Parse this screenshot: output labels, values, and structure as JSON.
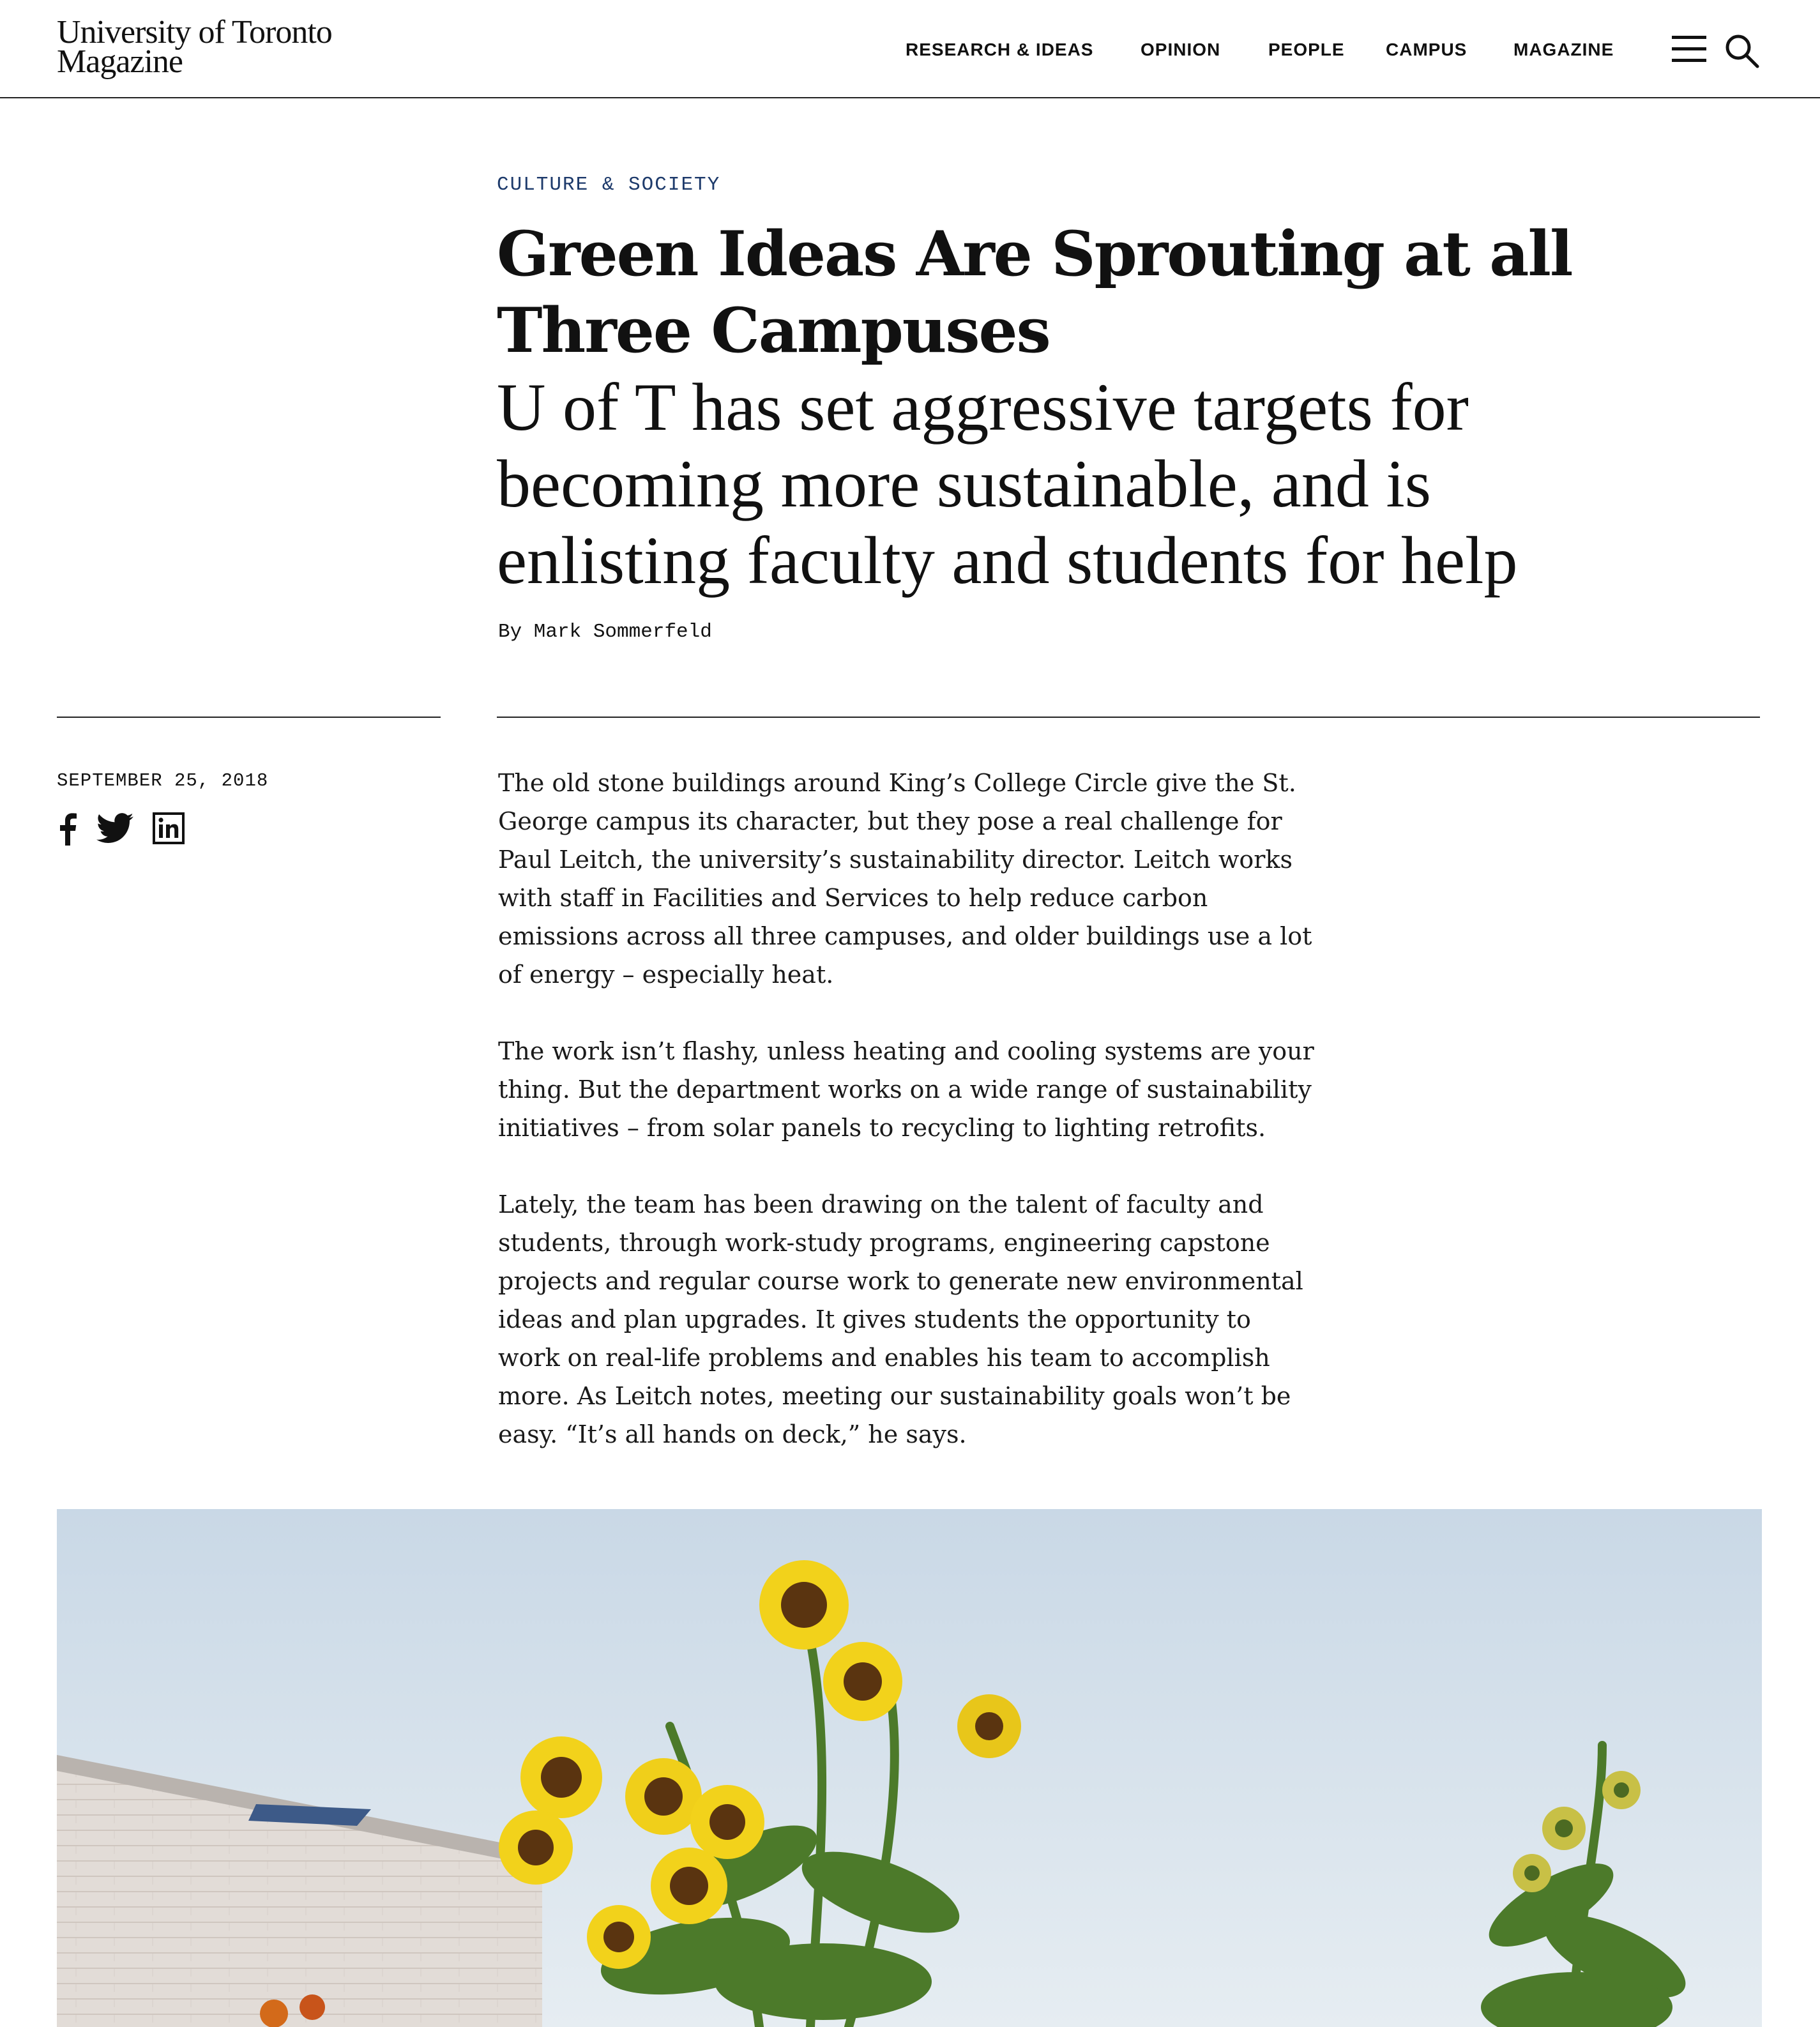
{
  "site": {
    "logo_line1": "University of Toronto",
    "logo_line2": "Magazine"
  },
  "nav": {
    "items": [
      {
        "label": "RESEARCH & IDEAS"
      },
      {
        "label": "OPINION"
      },
      {
        "label": "PEOPLE"
      },
      {
        "label": "CAMPUS"
      },
      {
        "label": "MAGAZINE"
      }
    ],
    "menu_icon": "hamburger-icon",
    "search_icon": "search-icon"
  },
  "article": {
    "category": "CULTURE & SOCIETY",
    "title": "Green Ideas Are Sprouting at all Three Campuses",
    "subtitle": "U of T has set aggressive targets for becoming more sustainable, and is enlisting faculty and students for help",
    "byline": "By Mark Sommerfeld",
    "date": "SEPTEMBER 25, 2018",
    "share_icons": [
      "facebook-icon",
      "twitter-icon",
      "linkedin-icon"
    ],
    "paragraphs": [
      "The old stone buildings around King’s College Circle give the St. George campus its character, but they pose a real challenge for Paul Leitch, the university’s sustainability director. Leitch works with staff in Facilities and Services to help reduce carbon emissions across all three campuses, and older buildings use a lot of energy – especially heat.",
      "The work isn’t flashy, unless heating and cooling systems are your thing. But the department works on a wide range of sustainability initiatives – from solar panels to recycling to lighting retrofits.",
      "Lately, the team has been drawing on the talent of faculty and students, through work-study programs, engineering capstone projects and regular course work to generate new environmental ideas and plan upgrades. It gives students the opportunity to work on real-life problems and enables his team to accomplish more. As Leitch notes, meeting our sustainability goals won’t be easy. “It’s all hands on deck,” he says."
    ]
  },
  "colors": {
    "kicker": "#1d3a6b",
    "text": "#111111",
    "sky": "#dfe8f0",
    "sunflower_petal": "#f2d21b",
    "sunflower_center": "#5a3410",
    "leaf": "#4c7a2a"
  }
}
